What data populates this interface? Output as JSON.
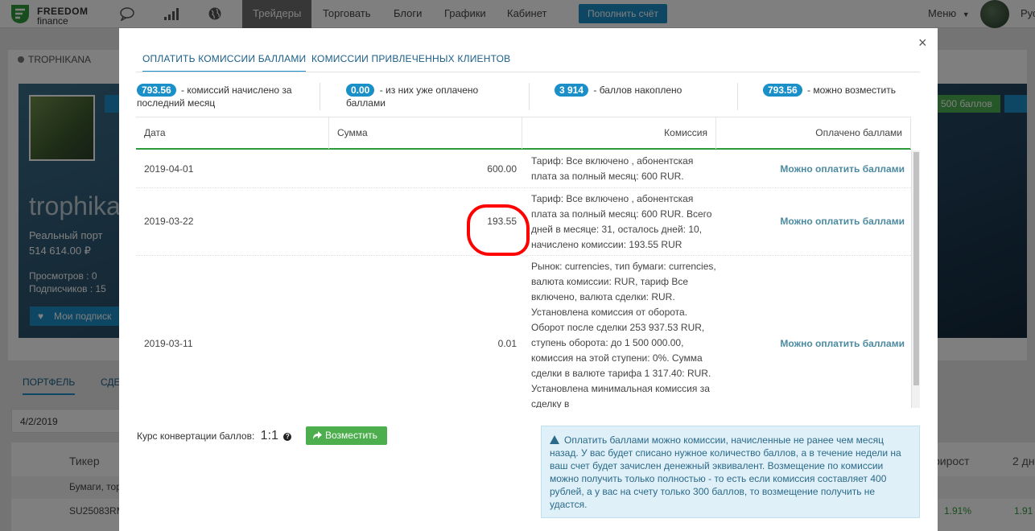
{
  "nav": {
    "logo_line1": "FREEDOM",
    "logo_line2": "finance",
    "links": [
      "Трейдеры",
      "Торговать",
      "Блоги",
      "Графики",
      "Кабинет"
    ],
    "deposit_button": "Пополнить счёт",
    "menu": "Меню",
    "lang": "Рус"
  },
  "background": {
    "user": "TROPHIKANA",
    "cover_name": "trophika",
    "portfolio_label": "Реальный порт",
    "portfolio_value": "514 614.00 ₽",
    "views": "Просмотров : 0",
    "subscribers": "Подписчиков : 15",
    "subscriptions_button": "Мои подписк",
    "points_button": "500 баллов",
    "tabs": [
      "ПОРТФЕЛЬ",
      "СДЕ"
    ],
    "date": "4/2/2019",
    "col_ticker": "Тикер",
    "col_growth": "рирост",
    "col_2days": "2 дн",
    "group_row": "Бумаги, тор",
    "ticker_row": "SU25083RM",
    "growth_val": "1.91%",
    "growth_val2": "1.91"
  },
  "modal": {
    "tabs": [
      "ОПЛАТИТЬ КОМИССИИ БАЛЛАМИ",
      "КОМИССИИ ПРИВЛЕЧЕННЫХ КЛИЕНТОВ"
    ],
    "stats": [
      {
        "value": "793.56",
        "label": "- комиссий начислено за последний месяц"
      },
      {
        "value": "0.00",
        "label": "- из них уже оплачено баллами"
      },
      {
        "value": "3 914",
        "label": "- баллов накоплено"
      },
      {
        "value": "793.56",
        "label": "- можно возместить"
      }
    ],
    "columns": [
      "Дата",
      "Сумма",
      "Комиссия",
      "Оплачено баллами"
    ],
    "rows": [
      {
        "date": "2019-04-01",
        "sum": "600.00",
        "commission": "Тариф: Все включено , абонентская плата за полный месяц: 600 RUR.",
        "paid": "Можно оплатить баллами"
      },
      {
        "date": "2019-03-22",
        "sum": "193.55",
        "commission": "Тариф: Все включено , абонентская плата за полный месяц: 600 RUR. Всего дней в месяце: 31, осталось дней: 10, начислено комиссии: 193.55 RUR",
        "paid": "Можно оплатить баллами"
      },
      {
        "date": "2019-03-11",
        "sum": "0.01",
        "commission": "Рынок: currencies, тип бумаги: currencies, валюта комиссии: RUR, тариф Все включено, валюта сделки: RUR. Установлена комиссия от оборота. Оборот после сделки 253 937.53 RUR, ступень оборота: до 1 500 000.00, комиссия на этой ступени: 0%. Сумма сделки в валюте тарифа 1 317.40: RUR. Установлена минимальная комиссия за сделку в",
        "paid": "Можно оплатить баллами"
      }
    ],
    "conversion_label": "Курс конвертации баллов:",
    "conversion_value": "1:1",
    "reimburse_button": "Возместить",
    "info_text": "Оплатить баллами можно комиссии, начисленные не ранее чем месяц назад. У вас будет списано нужное количество баллов, а в течение недели на ваш счет будет зачислен денежный эквивалент. Возмещение по комиссии можно получить только полностью - то есть если комиссия составляет 400 рублей, а у вас на счету только 300 баллов, то возмещение получить не удастся."
  },
  "colors": {
    "accent": "#1a8fc8",
    "green": "#4cae4c",
    "highlight": "#ff0000"
  }
}
